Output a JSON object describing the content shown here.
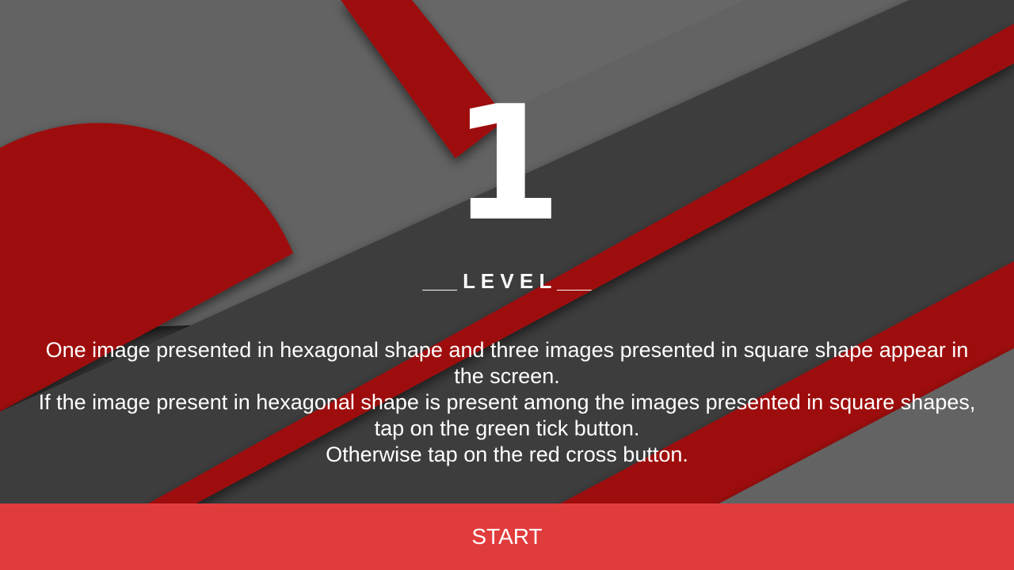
{
  "level": {
    "number": "1",
    "label": "___ L E V E L ___"
  },
  "instructions": [
    "One image presented in hexagonal shape and three images presented in square shape appear in the screen.",
    "If the image present in hexagonal shape is present among the images presented in square shapes, tap on the green tick button.",
    "Otherwise tap on the red cross button."
  ],
  "start_button": {
    "label": "START"
  },
  "colors": {
    "background_dark": "#3d3d3d",
    "background_gray": "#636463",
    "accent_red": "#9e0a10",
    "button_red": "#e13c3c",
    "text": "#ffffff"
  }
}
